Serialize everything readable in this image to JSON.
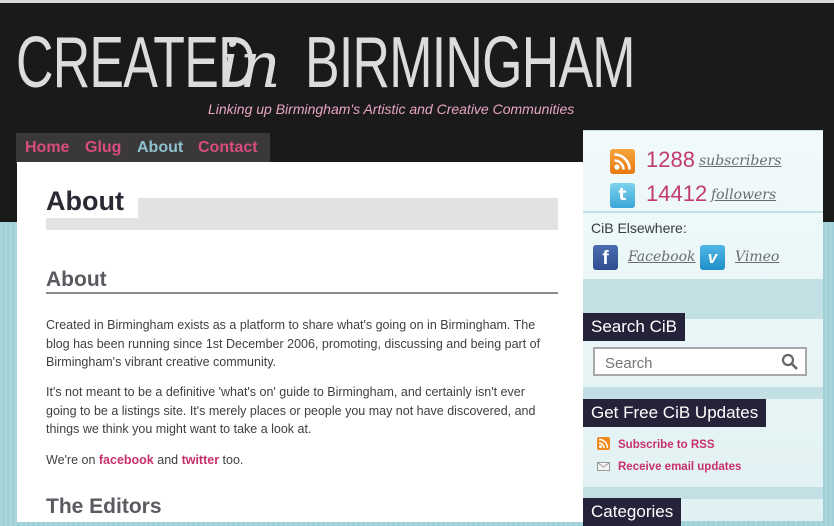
{
  "header": {
    "logo_word1": "CREATED",
    "logo_word2": "in",
    "logo_word3": "BIRMINGHAM",
    "tagline": "Linking up Birmingham's Artistic and Creative Communities"
  },
  "nav": {
    "items": [
      {
        "label": "Home"
      },
      {
        "label": "Glug"
      },
      {
        "label": "About",
        "active": true
      },
      {
        "label": "Contact"
      }
    ]
  },
  "main": {
    "page_title": "About",
    "section1_heading": "About",
    "paragraph1": "Created in Birmingham exists as a platform to share what's going on in Birmingham. The blog has been running since 1st December 2006, promoting, discussing and being part of Birmingham's vibrant creative community.",
    "paragraph2": "It's not meant to be a definitive 'what's on' guide to Birmingham, and certainly isn't ever going to be a listings site. It's merely places or people you may not have discovered, and things we think you might want to take a look at.",
    "paragraph3_prefix": "We're on ",
    "paragraph3_link1": "facebook",
    "paragraph3_and": " and ",
    "paragraph3_link2": "twitter",
    "paragraph3_suffix": " too.",
    "section2_heading": "The Editors"
  },
  "sidebar": {
    "rss_count": "1288",
    "rss_label": "subscribers",
    "twitter_count": "14412",
    "twitter_label": "followers",
    "elsewhere_label": "CiB Elsewhere:",
    "facebook_label": "Facebook",
    "vimeo_label": "Vimeo",
    "search_title": "Search CiB",
    "search_placeholder": "Search",
    "updates_title": "Get Free CiB Updates",
    "subscribe_rss": "Subscribe to RSS",
    "email_updates": "Receive email updates",
    "categories_title": "Categories"
  },
  "colors": {
    "header_bg": "#1b1a1a",
    "nav_link": "#d94c7f",
    "nav_active": "#8fc2cf",
    "accent_pink": "#c8306b",
    "sidebar_title_bg": "#25233a",
    "page_bg": "#9fd0d8"
  },
  "icons": [
    "rss-icon",
    "twitter-icon",
    "facebook-icon",
    "vimeo-icon",
    "search-icon",
    "email-icon"
  ]
}
